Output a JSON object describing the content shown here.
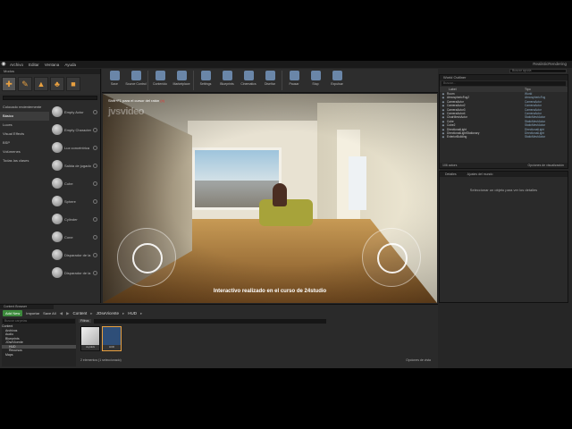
{
  "menubar": {
    "items": [
      "Archivo",
      "Editar",
      "Ventana",
      "Ayuda"
    ],
    "project": "RealisticRendering",
    "search_placeholder": "Buscar ayuda"
  },
  "modes": {
    "tab": "Modos",
    "categories": [
      "Colocado recientemente",
      "Básico",
      "Luces",
      "Visual Effects",
      "BSP",
      "Volúmenes",
      "Todas las clases"
    ],
    "actors": [
      "Empty Actor",
      "Empty Character",
      "Luz concéntrica",
      "Salida de jugado",
      "Cube",
      "Sphere",
      "Cylinder",
      "Cone",
      "Disparador de la",
      "Disparador de la"
    ]
  },
  "toolbar": {
    "buttons": [
      "Save",
      "Source Control",
      "Contenido",
      "Marketplace",
      "Settings",
      "Blueprints",
      "Cinematics",
      "Diseñar",
      "Pausar",
      "Stop",
      "Expulsar"
    ]
  },
  "viewport": {
    "hint": "Shift+F1 para el cursor del ratón",
    "hint_x": "(x)",
    "logo": "jvsvideo",
    "caption": "Interactivo realizado en el curso de 24studio"
  },
  "outliner": {
    "tab": "World Outliner",
    "search_placeholder": "Buscar...",
    "col_label": "Label",
    "col_type": "Tipo",
    "rows": [
      {
        "name": "Room",
        "type": "World"
      },
      {
        "name": "AtmosphericFog2",
        "type": "AtmosphericFog"
      },
      {
        "name": "CameraActor",
        "type": "CameraActor"
      },
      {
        "name": "CameraActor2",
        "type": "CameraActor"
      },
      {
        "name": "CameraActor3",
        "type": "CameraActor"
      },
      {
        "name": "CameraActor4",
        "type": "CameraActor"
      },
      {
        "name": "ChairMeshActor",
        "type": "StaticMeshActor"
      },
      {
        "name": "Cube",
        "type": "StaticMeshActor"
      },
      {
        "name": "Cube2",
        "type": "StaticMeshActor"
      },
      {
        "name": "DirectionalLight",
        "type": "DirectionalLight"
      },
      {
        "name": "DirectionalLightStationary",
        "type": "DirectionalLight"
      },
      {
        "name": "ExteriorBuilding",
        "type": "StaticMeshActor"
      }
    ],
    "footer": "106 actors",
    "view_options": "Opciones de visualización"
  },
  "details": {
    "tabs": [
      "Detalles",
      "Ajustes del mundo"
    ],
    "message": "Seleccionar un objeto para ver los detalles"
  },
  "content_browser": {
    "tab": "Content Browser",
    "add_new": "Add New",
    "import": "Importar",
    "save_all": "Save All",
    "breadcrumb": [
      "Content",
      "JOseVicente",
      "HUD"
    ],
    "tree_search": "Buscar carpetas",
    "tree": [
      "Content",
      "Archivos",
      "Audio",
      "Blueprints",
      "JOseVicente",
      "HUD",
      "Recursos",
      "Maps"
    ],
    "filters_label": "Filtros",
    "assets": [
      {
        "name": "Joystick"
      },
      {
        "name": "HUD"
      }
    ],
    "status": "2 elementos (1 seleccionado)",
    "view_options": "Opciones de vista"
  }
}
